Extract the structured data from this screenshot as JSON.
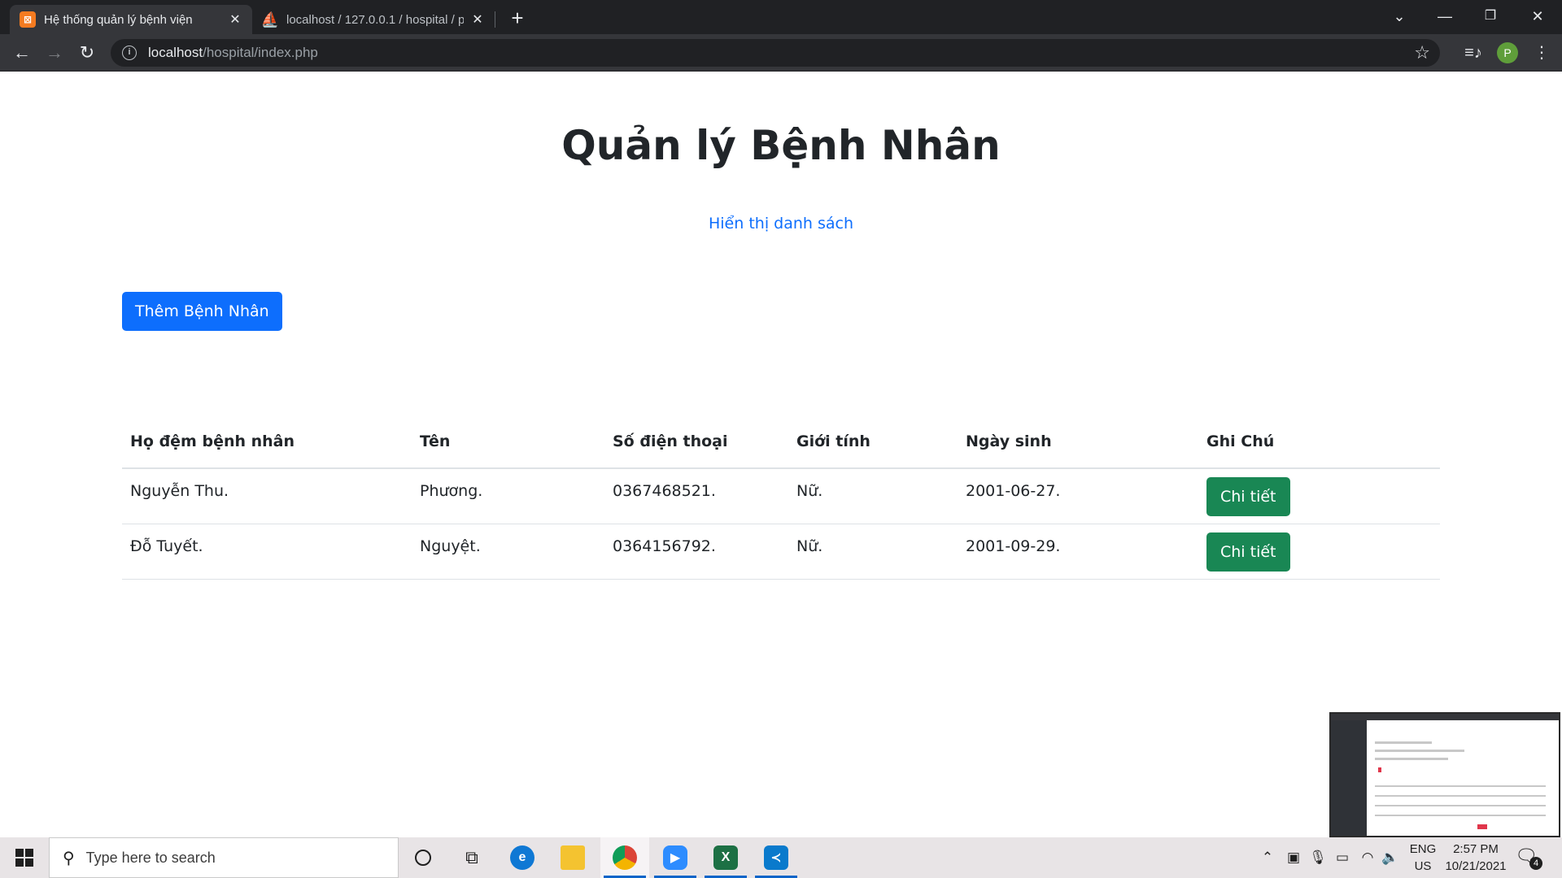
{
  "browser": {
    "tabs": [
      {
        "title": "Hệ thống quản lý bệnh viện",
        "active": true,
        "icon": "xampp-icon"
      },
      {
        "title": "localhost / 127.0.0.1 / hospital / p",
        "active": false,
        "icon": "phpmyadmin-icon"
      }
    ],
    "url_host": "localhost",
    "url_path": "/hospital/index.php",
    "profile_initial": "P"
  },
  "page": {
    "title": "Quản lý Bệnh Nhân",
    "list_link": "Hiển thị danh sách",
    "add_button": "Thêm Bệnh Nhân",
    "table": {
      "headers": [
        "Họ đệm bệnh nhân",
        "Tên",
        "Số điện thoại",
        "Giới tính",
        "Ngày sinh",
        "Ghi Chú"
      ],
      "rows": [
        {
          "last_middle": "Nguyễn Thu.",
          "first": "Phương.",
          "phone": "0367468521.",
          "gender": "Nữ.",
          "dob": "2001-06-27.",
          "action": "Chi tiết"
        },
        {
          "last_middle": "Đỗ Tuyết.",
          "first": "Nguyệt.",
          "phone": "0364156792.",
          "gender": "Nữ.",
          "dob": "2001-09-29.",
          "action": "Chi tiết"
        }
      ]
    }
  },
  "taskbar": {
    "search_placeholder": "Type here to search",
    "lang_top": "ENG",
    "lang_bottom": "US",
    "time": "2:57 PM",
    "date": "10/21/2021",
    "notification_count": "4"
  },
  "colors": {
    "primary": "#0d6efd",
    "success": "#198754",
    "chrome_dark": "#202124",
    "chrome_toolbar": "#35363a"
  }
}
